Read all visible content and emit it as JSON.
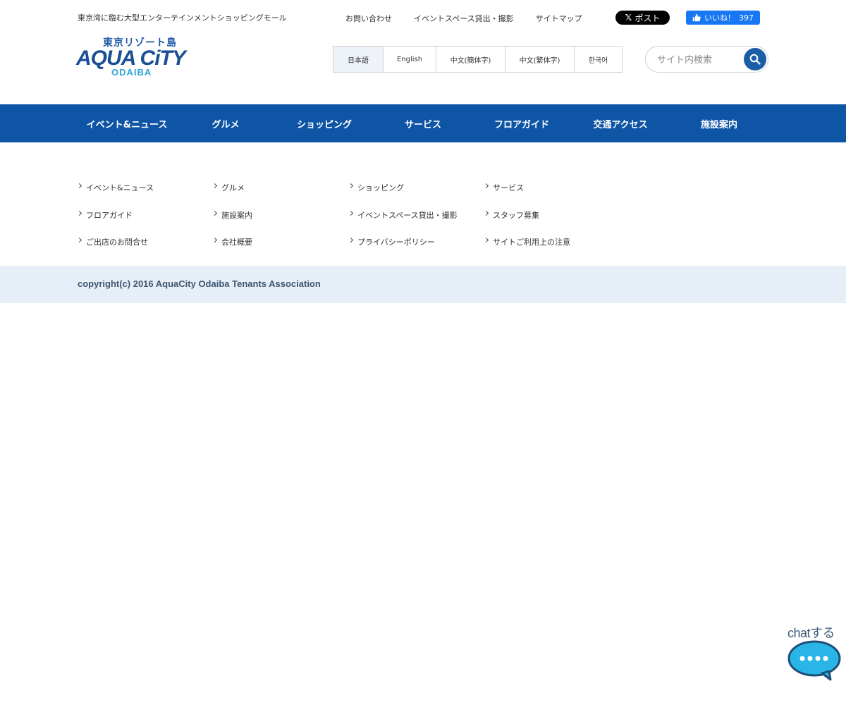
{
  "header": {
    "tagline": "東京湾に臨む大型エンターテインメントショッピングモール",
    "logo": {
      "jp_text": "東京リゾート島",
      "main_text": "AQUA CiTY",
      "sub_text": "ODAIBA"
    },
    "top_links": [
      "お問い合わせ",
      "イベントスペース貸出・撮影",
      "サイトマップ"
    ],
    "x_button_label": "ポスト",
    "fb_button_label": "いいね！",
    "fb_count": "397",
    "languages": [
      {
        "label": "日本語",
        "active": true
      },
      {
        "label": "English",
        "active": false
      },
      {
        "label": "中文(簡体字)",
        "active": false
      },
      {
        "label": "中文(繁体字)",
        "active": false
      },
      {
        "label": "한국어",
        "active": false
      }
    ],
    "search": {
      "placeholder": "サイト内検索",
      "value": ""
    }
  },
  "nav": {
    "items": [
      "イベント&ニュース",
      "グルメ",
      "ショッピング",
      "サービス",
      "フロアガイド",
      "交通アクセス",
      "施設案内"
    ]
  },
  "sitemap": {
    "links": [
      "イベント&ニュース",
      "グルメ",
      "ショッピング",
      "サービス",
      "フロアガイド",
      "施設案内",
      "イベントスペース貸出・撮影",
      "スタッフ募集",
      "ご出店のお問合せ",
      "会社概要",
      "プライバシーポリシー",
      "サイトご利用上の注意"
    ]
  },
  "footer": {
    "copyright": "copyright(c) 2016 AquaCity Odaiba Tenants Association"
  },
  "chat_widget": {
    "label": "chatする"
  },
  "colors": {
    "nav_bg": "#0e55a5",
    "footer_bg": "#e6eef8",
    "search_button": "#1b5ea8",
    "facebook": "#1877f2",
    "chat_bubble": "#29b6e6"
  },
  "icons": {
    "search": "magnifier-icon",
    "x": "x-logo-icon",
    "facebook": "thumbs-up-icon",
    "chevron": "chevron-right-icon",
    "chat": "speech-bubble-icon"
  }
}
